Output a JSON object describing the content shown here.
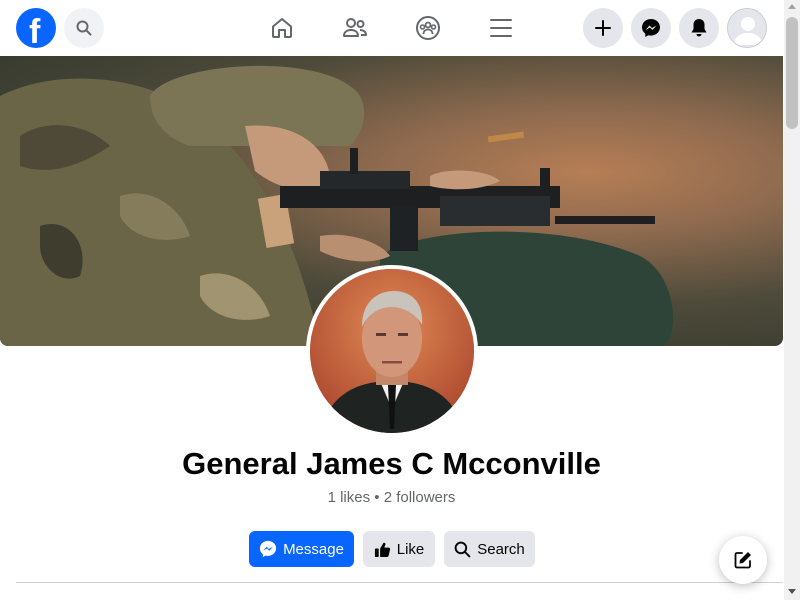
{
  "topbar": {
    "logo_letter": "f",
    "icons": {
      "search": "search-icon",
      "home": "home-icon",
      "friends": "friends-icon",
      "groups": "groups-icon",
      "menu": "menu-icon",
      "create": "plus-icon",
      "messenger": "messenger-icon",
      "notifications": "bell-icon",
      "account": "avatar-icon"
    }
  },
  "profile": {
    "name": "General James C Mcconville",
    "stats": "1 likes • 2 followers"
  },
  "actions": {
    "message_label": "Message",
    "like_label": "Like",
    "search_label": "Search"
  },
  "colors": {
    "brand": "#0866ff",
    "button_secondary": "#e4e6eb",
    "text_primary": "#050505",
    "text_secondary": "#65676b"
  }
}
